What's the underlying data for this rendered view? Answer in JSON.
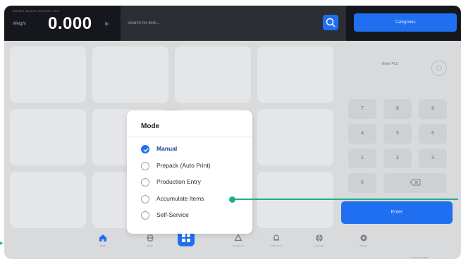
{
  "header": {
    "weight_status": "GROSS  BLAHS  HXXXXX  XXX",
    "weight_label": "Weight",
    "weight_value": "0.000",
    "weight_unit": "lb",
    "search_placeholder": "Search for item...",
    "categories_label": "Categories"
  },
  "plu": {
    "label": "Enter PLU",
    "keys": [
      "7",
      "8",
      "9",
      "4",
      "5",
      "6",
      "1",
      "2",
      "3",
      "0"
    ],
    "enter_label": "Enter"
  },
  "nav": {
    "items": [
      {
        "label": "Home"
      },
      {
        "label": "Weigh"
      },
      {
        "label": "Department"
      },
      {
        "label": "Notifications"
      },
      {
        "label": "Language"
      },
      {
        "label": "Settings"
      }
    ],
    "status_text": "10:42  Jan 4 2024"
  },
  "mode_dialog": {
    "title": "Mode",
    "options": [
      {
        "label": "Manual",
        "selected": true
      },
      {
        "label": "Prepack (Auto Print)",
        "selected": false
      },
      {
        "label": "Production Entry",
        "selected": false
      },
      {
        "label": "Accumulate Items",
        "selected": false
      },
      {
        "label": "Self-Service",
        "selected": false
      }
    ]
  },
  "colors": {
    "accent": "#1f6ff0",
    "topbar": "#15171c",
    "callout": "#1fae8c"
  }
}
